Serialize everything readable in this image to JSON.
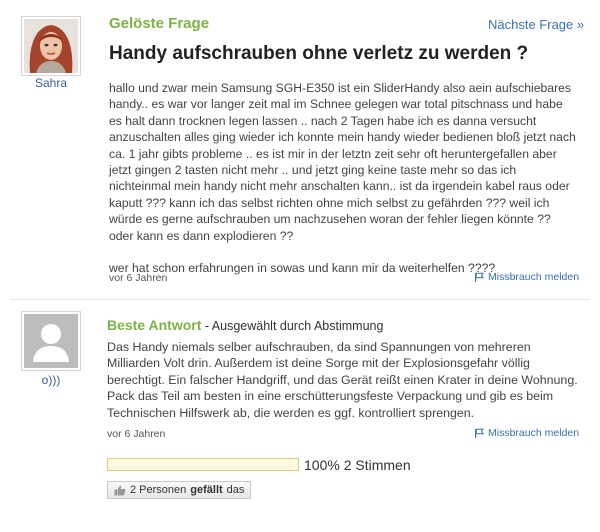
{
  "question": {
    "section_label": "Gelöste Frage",
    "next_link": "Nächste Frage »",
    "title": "Handy aufschrauben ohne verletz zu werden ?",
    "author": "Sahra",
    "body_lines": [
      "hallo und zwar mein Samsung SGH-E350 ist ein SliderHandy also aein aufschiebares",
      "handy.. es war vor langer zeit mal im Schnee gelegen war total pitschnass und habe",
      "es halt dann trocknen legen lassen .. nach 2 Tagen habe ich es danna versucht",
      "anzuschalten alles ging wieder ich konnte mein handy wieder bedienen bloß jetzt nach",
      "ca. 1 jahr gibts probleme .. es ist mir in der letztn zeit sehr oft heruntergefallen aber",
      "jetzt gingen 2 tasten nicht mehr .. und jetzt ging keine taste mehr so das ich",
      "nichteinmal mein handy nicht mehr anschalten kann.. ist da irgendein kabel raus oder",
      "kaputt ??? kann ich das selbst richten ohne mich selbst zu gefährden ??? weil ich",
      "würde es gerne aufschrauben um nachzusehen woran der fehler liegen könnte ??",
      "oder kann es dann explodieren ??"
    ],
    "body_last": "wer hat schon erfahrungen in sowas und kann mir da weiterhelfen ????",
    "timestamp": "vor 6 Jahren",
    "report_label": "Missbrauch melden"
  },
  "answer": {
    "section_label": "Beste Antwort",
    "section_sub": " - Ausgewählt durch Abstimmung",
    "author": "o)))",
    "body_lines": [
      "Das Handy niemals selber aufschrauben, da sind Spannungen von mehreren",
      "Milliarden Volt drin. Außerdem ist deine Sorge mit der Explosionsgefahr völlig",
      "berechtigt. Ein falscher Handgriff, und das Gerät reißt einen Krater in deine Wohnung.",
      "Pack das Teil am besten in eine erschütterungsfeste Verpackung und gib es beim",
      "Technischen Hilfswerk ab, die werden es ggf. kontrolliert sprengen."
    ],
    "timestamp": "vor 6 Jahren",
    "report_label": "Missbrauch melden",
    "vote_percent": 100,
    "vote_text": "100% 2 Stimmen",
    "like_count": "2 Personen ",
    "like_label": "gefällt",
    "like_suffix": " das"
  },
  "colors": {
    "accent_green": "#7cb342",
    "link_blue": "#3b6fb6"
  }
}
